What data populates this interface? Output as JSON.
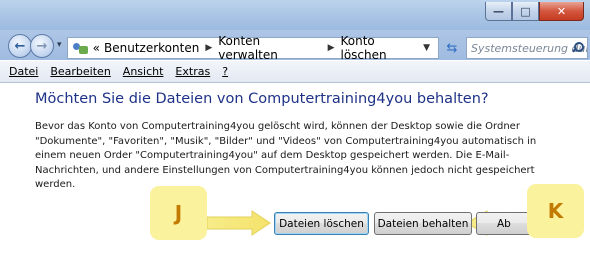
{
  "window": {
    "minimize_label": "—",
    "maximize_label": "□",
    "close_label": "✕"
  },
  "nav": {
    "back_glyph": "←",
    "forward_glyph": "→",
    "dropdown_glyph": "▾",
    "breadcrumb_prefix": "«",
    "breadcrumbs": [
      "Benutzerkonten",
      "Konten verwalten",
      "Konto löschen"
    ],
    "crumb_separator": "▶",
    "address_dropdown_glyph": "▼",
    "refresh_glyph": "⇆",
    "search_placeholder": "Systemsteuerung durc..."
  },
  "menubar": {
    "items": [
      "Datei",
      "Bearbeiten",
      "Ansicht",
      "Extras",
      "?"
    ]
  },
  "content": {
    "question": "Möchten Sie die Dateien von Computertraining4you behalten?",
    "description": "Bevor das Konto von Computertraining4you gelöscht wird, können der Desktop sowie die Ordner \"Dokumente\", \"Favoriten\", \"Musik\", \"Bilder\" und \"Videos\" von Computertraining4you automatisch in einem neuen Order \"Computertraining4you\" auf dem Desktop gespeichert werden. Die E-Mail-Nachrichten, und andere Einstellungen von Computertraining4you können jedoch nicht gespeichert werden."
  },
  "buttons": {
    "delete_files": "Dateien löschen",
    "keep_files": "Dateien behalten",
    "cancel": "Ab"
  },
  "annotations": {
    "left_label": "J",
    "right_label": "K",
    "highlight_color": "#fbf29e",
    "label_text_color": "#c27a00"
  }
}
